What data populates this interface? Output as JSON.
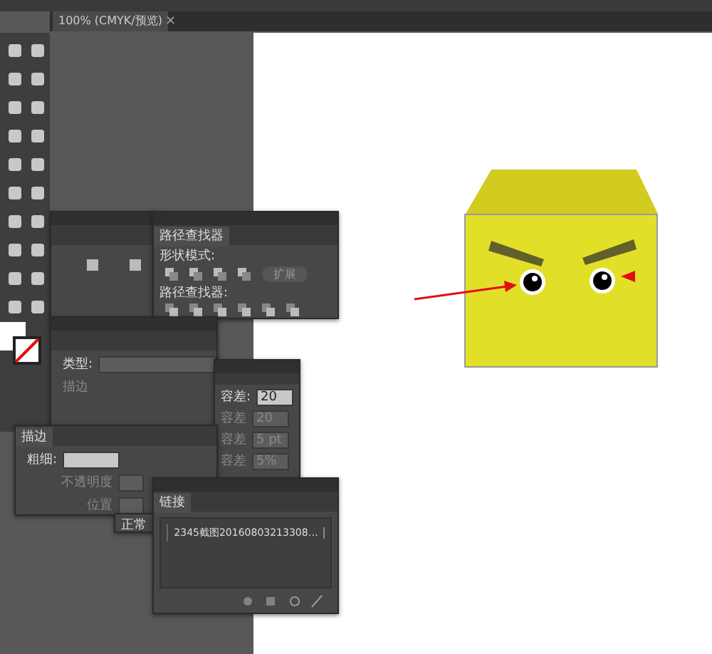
{
  "document_tab": {
    "title": "100% (CMYK/预览)",
    "close": "×"
  },
  "pathfinder_panel": {
    "title": "路径查找器",
    "shape_modes_label": "形状模式:",
    "expand_button": "扩展",
    "pathfinders_label": "路径查找器:"
  },
  "gradient_panel": {
    "type_label": "类型:",
    "stroke_label": "描边"
  },
  "magic_wand_panel": {
    "rows": [
      {
        "label": "容差:",
        "value": "20",
        "disabled": false
      },
      {
        "label": "容差",
        "value": "20",
        "disabled": true
      },
      {
        "label": "容差",
        "value": "5 pt",
        "disabled": true
      },
      {
        "label": "容差",
        "value": "5%",
        "disabled": true
      }
    ]
  },
  "stroke_panel": {
    "tab": "描边",
    "weight_label": "粗细:",
    "opacity_label": "不透明度",
    "position_label": "位置"
  },
  "blend_mode": "正常",
  "links_panel": {
    "tab": "链接",
    "items": [
      {
        "name": "2345截图20160803213308…"
      }
    ]
  }
}
